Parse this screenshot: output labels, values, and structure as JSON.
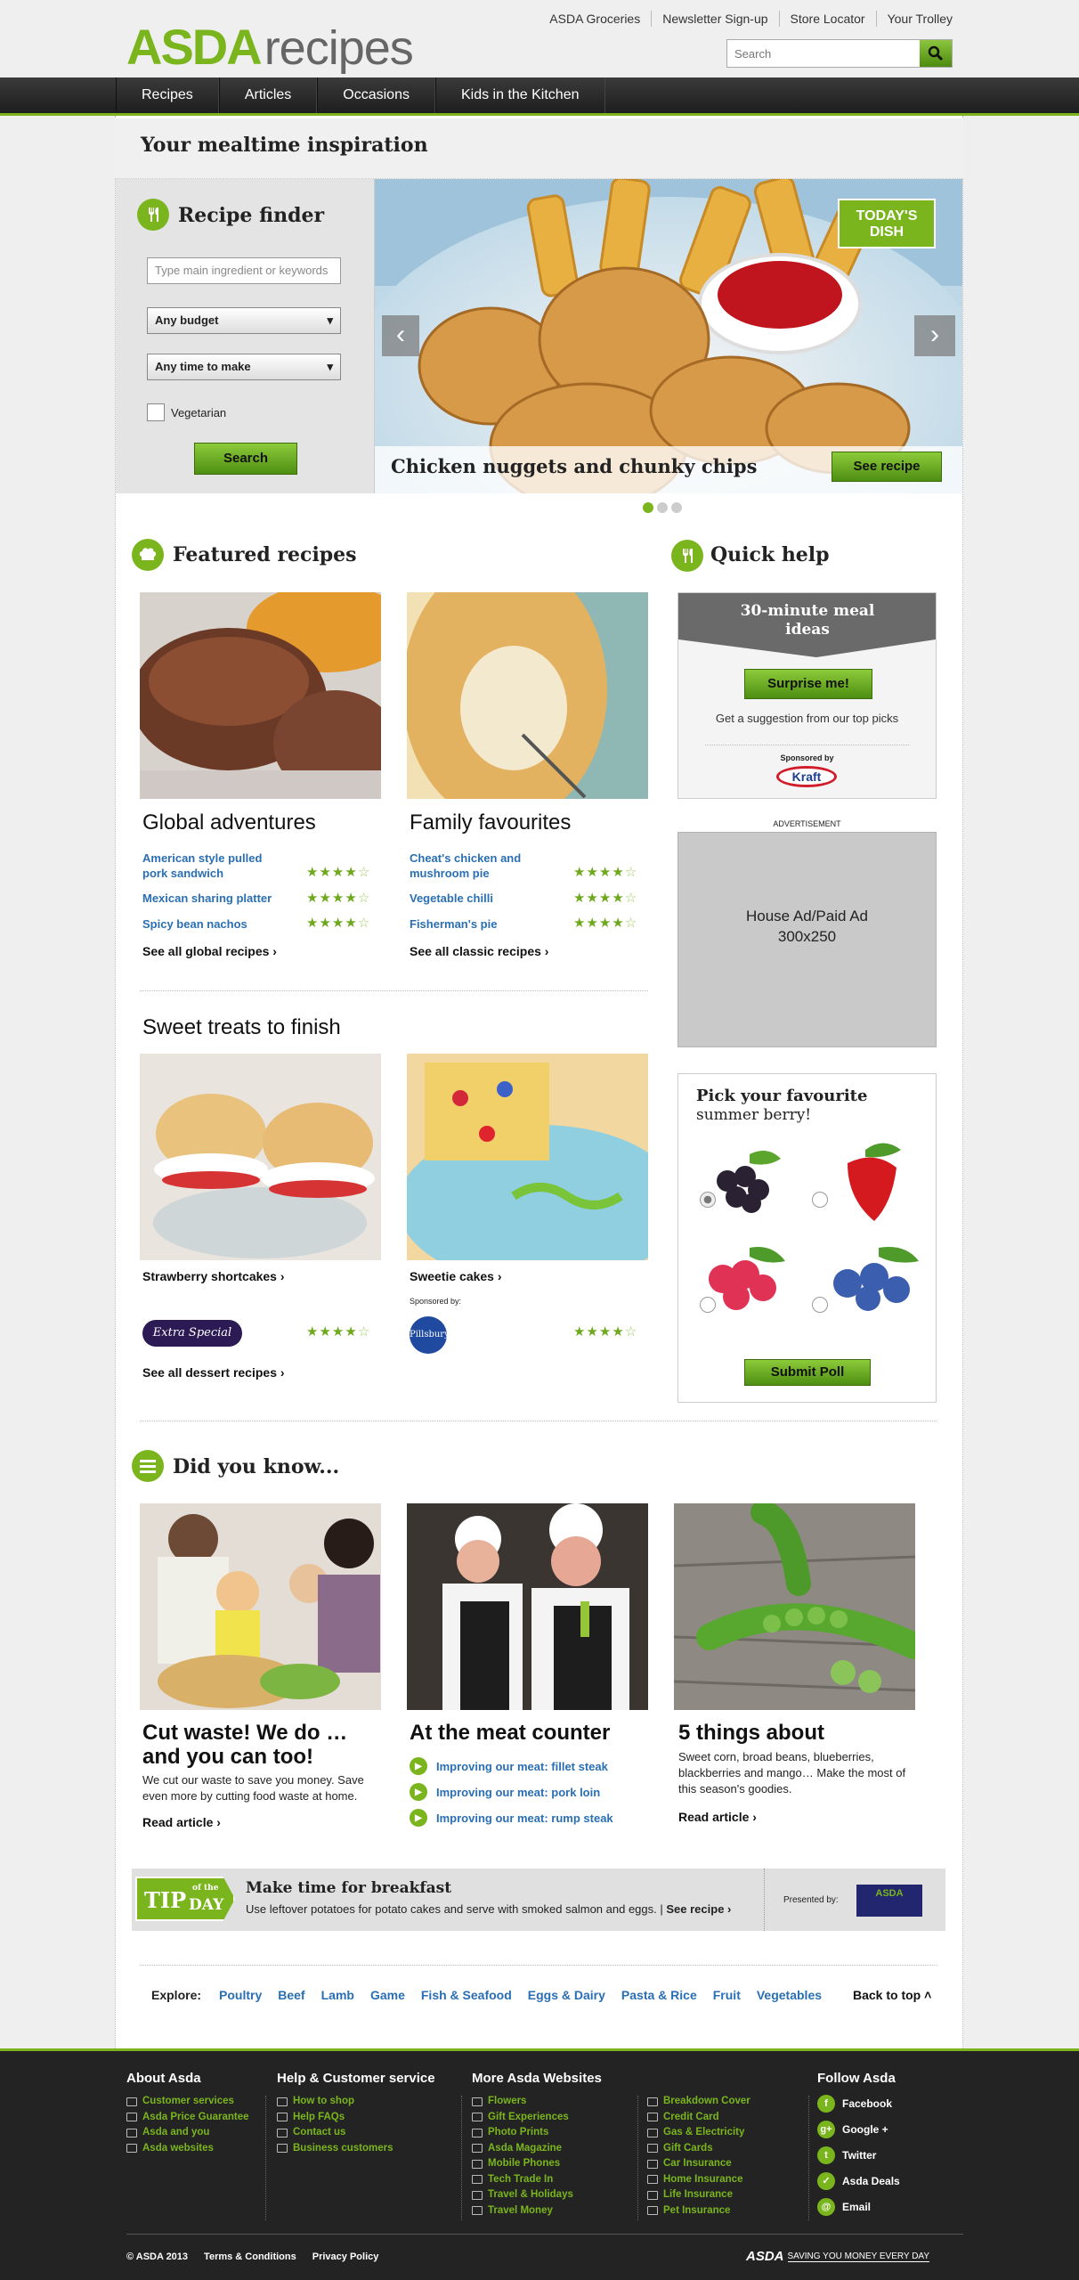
{
  "header": {
    "logo_brand": "ASDA",
    "logo_sub": "recipes",
    "top_links": [
      "ASDA Groceries",
      "Newsletter Sign-up",
      "Store Locator",
      "Your Trolley"
    ],
    "search_placeholder": "Search"
  },
  "nav": [
    "Recipes",
    "Articles",
    "Occasions",
    "Kids in the Kitchen"
  ],
  "page_title": "Your mealtime inspiration",
  "finder": {
    "title": "Recipe finder",
    "ingredient_placeholder": "Type main ingredient or keywords",
    "budget": "Any budget",
    "time": "Any time to make",
    "vegetarian": "Vegetarian",
    "search": "Search"
  },
  "hero": {
    "badge": "TODAY'S DISH",
    "dish": "Chicken nuggets and chunky chips",
    "see_recipe": "See recipe"
  },
  "featured": {
    "title": "Featured recipes",
    "global": {
      "heading": "Global adventures",
      "items": [
        "American style pulled pork sandwich",
        "Mexican sharing platter",
        "Spicy bean nachos"
      ],
      "ratings": [
        4,
        4,
        4
      ],
      "see_all": "See all global recipes"
    },
    "family": {
      "heading": "Family favourites",
      "items": [
        "Cheat's chicken and mushroom pie",
        "Vegetable chilli",
        "Fisherman's pie"
      ],
      "ratings": [
        4,
        4,
        4
      ],
      "see_all": "See all classic recipes"
    }
  },
  "sweet": {
    "heading": "Sweet treats to finish",
    "item1": "Strawberry shortcakes",
    "item2": "Sweetie cakes",
    "sponsor_label": "Sponsored by:",
    "logo1": "Extra Special",
    "logo2": "Pillsbury",
    "ratings": [
      4,
      4
    ],
    "see_all": "See all dessert recipes"
  },
  "quickhelp": {
    "title": "Quick help",
    "banner": "30-minute meal ideas",
    "surprise": "Surprise me!",
    "desc": "Get a suggestion from our top picks",
    "sponsored": "Sponsored by",
    "sponsor": "Kraft"
  },
  "ad": {
    "label": "ADVERTISEMENT",
    "text1": "House Ad/Paid Ad",
    "text2": "300x250"
  },
  "poll": {
    "title": "Pick your favourite",
    "subtitle": "summer berry!",
    "submit": "Submit Poll"
  },
  "didyouknow": {
    "title": "Did you know...",
    "col1": {
      "heading": "Cut waste! We do … and you can too!",
      "text": "We cut our waste to save you money. Save even more by cutting food waste at home.",
      "link": "Read article"
    },
    "col2": {
      "heading": "At the meat counter",
      "links": [
        "Improving our meat: fillet steak",
        "Improving our meat: pork loin",
        "Improving our meat: rump steak"
      ]
    },
    "col3": {
      "heading": "5 things about",
      "text": "Sweet corn, broad beans, blueberries, blackberries and mango… Make the most of this season's goodies.",
      "link": "Read article"
    }
  },
  "tip": {
    "badge_tip": "TIP",
    "badge_of": "of the",
    "badge_day": "DAY",
    "title": "Make time for breakfast",
    "text": "Use leftover potatoes for potato cakes and serve with smoked salmon and eggs.",
    "see": "See recipe",
    "presented": "Presented by:",
    "logo": "ASDA"
  },
  "explore": {
    "label": "Explore:",
    "links": [
      "Poultry",
      "Beef",
      "Lamb",
      "Game",
      "Fish & Seafood",
      "Eggs & Dairy",
      "Pasta & Rice",
      "Fruit",
      "Vegetables"
    ],
    "back": "Back to top"
  },
  "footer": {
    "about": {
      "title": "About Asda",
      "links": [
        "Customer services",
        "Asda Price Guarantee",
        "Asda and you",
        "Asda websites"
      ]
    },
    "help": {
      "title": "Help & Customer service",
      "links": [
        "How to shop",
        "Help FAQs",
        "Contact us",
        "Business customers"
      ]
    },
    "more": {
      "title": "More Asda Websites",
      "links1": [
        "Flowers",
        "Gift Experiences",
        "Photo Prints",
        "Asda Magazine",
        "Mobile Phones",
        "Tech Trade In",
        "Travel & Holidays",
        "Travel Money"
      ],
      "links2": [
        "Breakdown Cover",
        "Credit Card",
        "Gas & Electricity",
        "Gift Cards",
        "Car Insurance",
        "Home Insurance",
        "Life Insurance",
        "Pet Insurance"
      ]
    },
    "follow": {
      "title": "Follow Asda",
      "links": [
        "Facebook",
        "Google +",
        "Twitter",
        "Asda Deals",
        "Email"
      ]
    },
    "copyright": "© ASDA 2013",
    "terms": "Terms & Conditions",
    "privacy": "Privacy Policy",
    "tagline_brand": "ASDA",
    "tagline": "SAVING YOU MONEY EVERY DAY"
  }
}
